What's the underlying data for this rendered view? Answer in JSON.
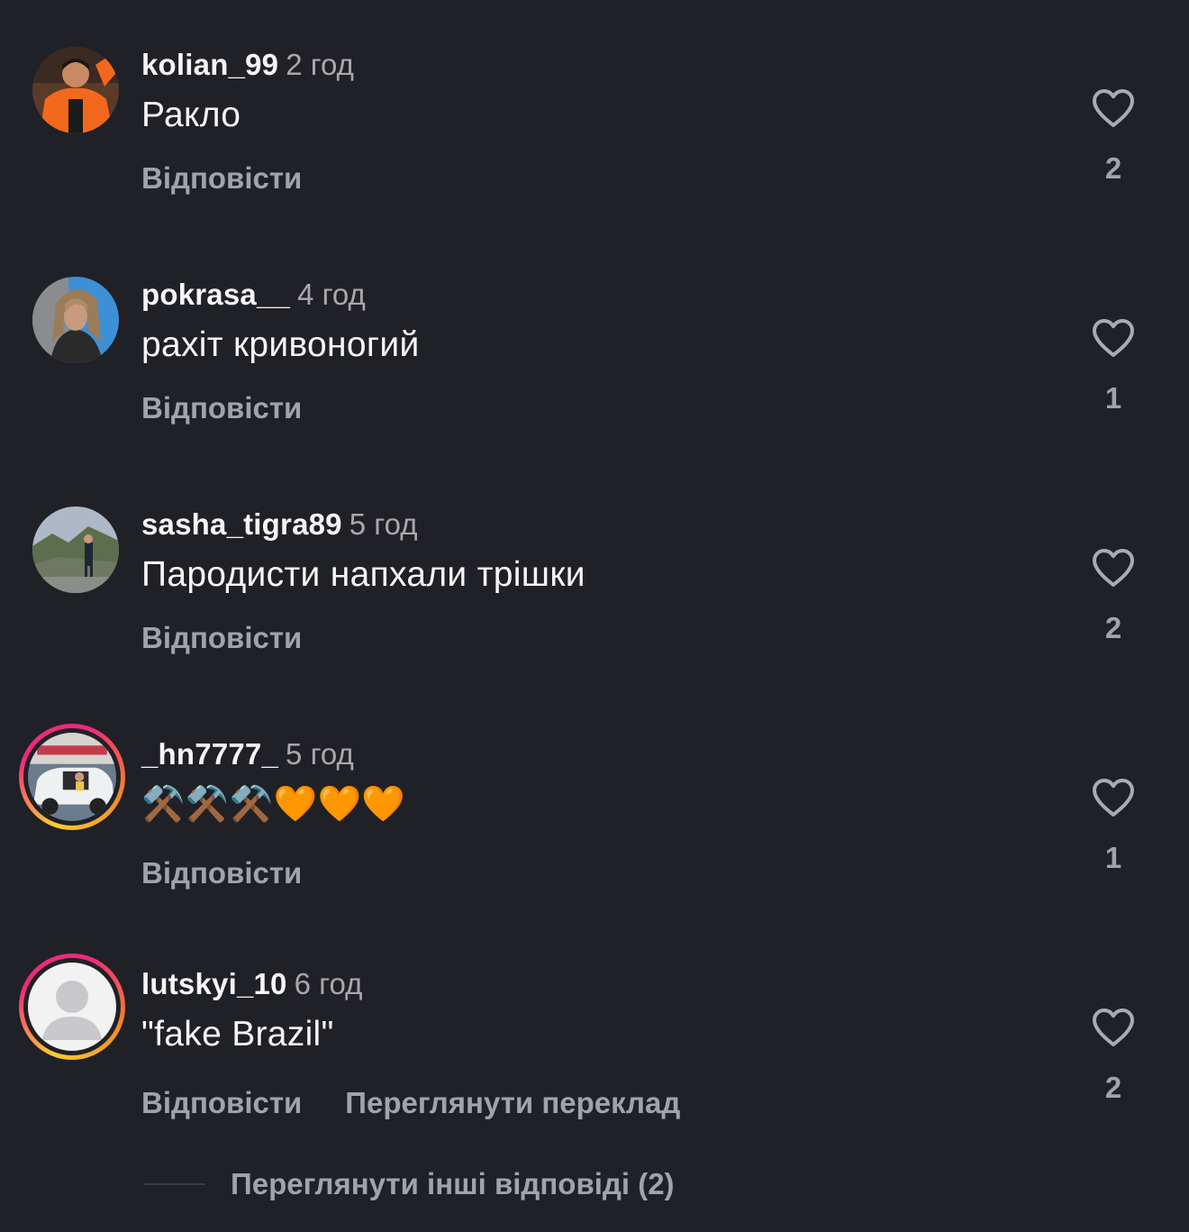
{
  "comments": [
    {
      "username": "kolian_99",
      "time": "2 год",
      "text": "Ракло",
      "reply_label": "Відповісти",
      "likes": "2",
      "avatar": "orange-jacket-person",
      "story_ring": false
    },
    {
      "username": "pokrasa__",
      "time": "4 год",
      "text": "рахіт кривоногий",
      "reply_label": "Відповісти",
      "likes": "1",
      "avatar": "long-hair-person",
      "story_ring": false
    },
    {
      "username": "sasha_tigra89",
      "time": "5 год",
      "text": "Пародисти напхали трішки",
      "reply_label": "Відповісти",
      "likes": "2",
      "avatar": "person-in-mountains",
      "story_ring": false
    },
    {
      "username": "_hn7777_",
      "time": "5 год",
      "text": "⚒️⚒️⚒️🧡🧡🧡",
      "reply_label": "Відповісти",
      "likes": "1",
      "avatar": "white-car",
      "story_ring": true
    },
    {
      "username": "lutskyi_10",
      "time": "6 год",
      "text": "\"fake Brazil\"",
      "reply_label": "Відповісти",
      "translate_label": "Переглянути переклад",
      "likes": "2",
      "avatar": "default-user-icon",
      "story_ring": true
    }
  ],
  "more_replies_label": "Переглянути інші відповіді (2)",
  "colors": {
    "background": "#202126",
    "primary_text": "#f5f5f5",
    "secondary_text": "#a0a3ab",
    "story_ring_start": "#f9ce34",
    "story_ring_end": "#ee2a7b"
  }
}
